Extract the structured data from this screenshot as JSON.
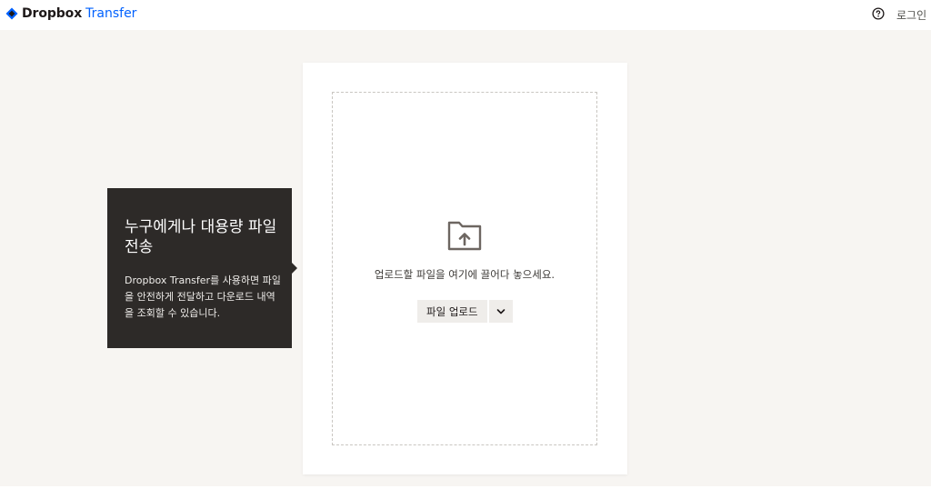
{
  "header": {
    "brand_name": "Dropbox",
    "brand_product": "Transfer",
    "login_label": "로그인",
    "icons": {
      "logo": "dropbox-logo-icon",
      "help": "help-circle-icon"
    }
  },
  "upload": {
    "drop_text": "업로드할 파일을 여기에 끌어다 놓으세요.",
    "upload_button_label": "파일 업로드",
    "icons": {
      "folder": "folder-upload-icon",
      "menu": "chevron-down-icon"
    }
  },
  "tooltip": {
    "title": "누구에게나 대용량 파일 전송",
    "body": "Dropbox Transfer를 사용하면 파일을 안전하게 전달하고 다운로드 내역을 조회할 수 있습니다."
  },
  "colors": {
    "accent": "#0061fe",
    "background": "#f7f5f2",
    "tooltip_bg": "#2d2a28",
    "button_bg": "#efedea"
  }
}
